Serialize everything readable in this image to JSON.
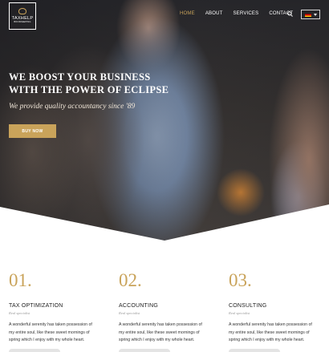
{
  "header": {
    "logo_name": "TAXHELP",
    "logo_sub": "BOOKKEEPING",
    "nav": [
      "HOME",
      "ABOUT",
      "SERVICES",
      "CONTACT"
    ],
    "search_icon": "search-icon",
    "language": "de"
  },
  "hero": {
    "headline_line1": "WE BOOST YOUR BUSINESS",
    "headline_line2": "WITH THE POWER OF ECLIPSE",
    "tagline": "We provide quality accountancy since '89",
    "button_label": "BUY NOW"
  },
  "features": [
    {
      "number": "01.",
      "title": "TAX OPTIMIZATION",
      "subtitle": "Real specialist",
      "text": "A wonderful serenity has taken possession of my entire soul, like these sweet mornings of spring which I enjoy with my whole heart."
    },
    {
      "number": "02.",
      "title": "ACCOUNTING",
      "subtitle": "Real specialist",
      "text": "A wonderful serenity has taken possession of my entire soul, like these sweet mornings of spring which I enjoy with my whole heart."
    },
    {
      "number": "03.",
      "title": "CONSULTING",
      "subtitle": "Real specialist",
      "text": "A wonderful serenity has taken possession of my entire soul, like these sweet mornings of spring which I enjoy with my whole heart."
    }
  ],
  "colors": {
    "accent": "#c9a35a",
    "text_dark": "#222222",
    "text_muted": "#9a9a9a"
  }
}
